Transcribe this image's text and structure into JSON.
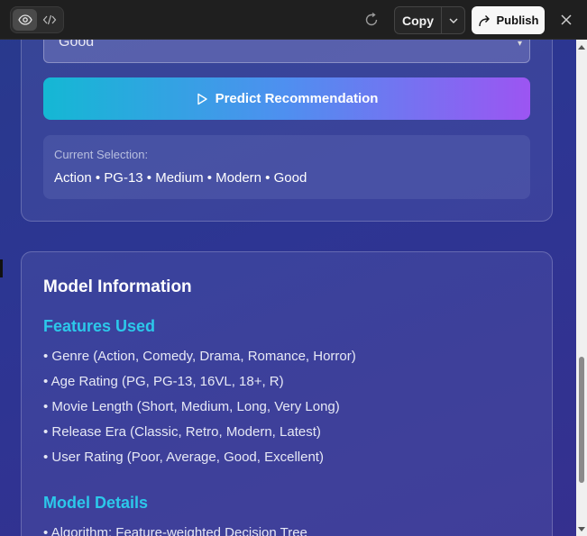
{
  "toolbar": {
    "copy_label": "Copy",
    "publish_label": "Publish",
    "icons": [
      "eye-icon",
      "code-icon",
      "refresh-icon",
      "chevron-down-icon",
      "share-arrow-icon",
      "close-icon"
    ]
  },
  "form": {
    "rating_value": "Good",
    "predict_label": "Predict Recommendation",
    "selection_label": "Current Selection:",
    "selection_value": "Action • PG-13 • Medium • Modern • Good"
  },
  "model": {
    "title": "Model Information",
    "features_title": "Features Used",
    "features": [
      "• Genre (Action, Comedy, Drama, Romance, Horror)",
      "• Age Rating (PG, PG-13, 16VL, 18+, R)",
      "• Movie Length (Short, Medium, Long, Very Long)",
      "• Release Era (Classic, Retro, Modern, Latest)",
      "• User Rating (Poor, Average, Good, Excellent)"
    ],
    "details_title": "Model Details",
    "details": [
      "• Algorithm: Feature-weighted Decision Tree"
    ]
  },
  "colors": {
    "accent_cyan": "#2cc8ea",
    "button_gradient_start": "#14b8d4",
    "button_gradient_end": "#9c55f2",
    "toolbar_bg": "#1f1f1f"
  }
}
